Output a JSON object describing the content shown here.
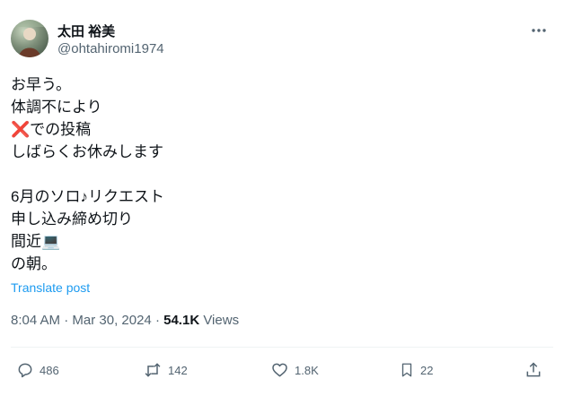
{
  "author": {
    "name": "太田 裕美",
    "handle": "@ohtahiromi1974"
  },
  "post": {
    "lines": [
      "お早う。",
      "体調不により",
      "❌での投稿",
      "しばらくお休みします",
      "",
      "6月のソロ♪リクエスト",
      "申し込み締め切り",
      "間近💻",
      "の朝。"
    ]
  },
  "translate_label": "Translate post",
  "meta": {
    "time": "8:04 AM",
    "separator": "·",
    "date": "Mar 30, 2024",
    "views_count": "54.1K",
    "views_label": "Views"
  },
  "actions": {
    "replies": "486",
    "reposts": "142",
    "likes": "1.8K",
    "bookmarks": "22"
  },
  "icons": {
    "more": "more-dots-icon",
    "reply": "reply-bubble-icon",
    "repost": "repost-icon",
    "like": "heart-icon",
    "bookmark": "bookmark-icon",
    "share": "share-icon"
  },
  "colors": {
    "accent": "#1d9bf0",
    "muted": "#536471",
    "text": "#0f1419"
  }
}
